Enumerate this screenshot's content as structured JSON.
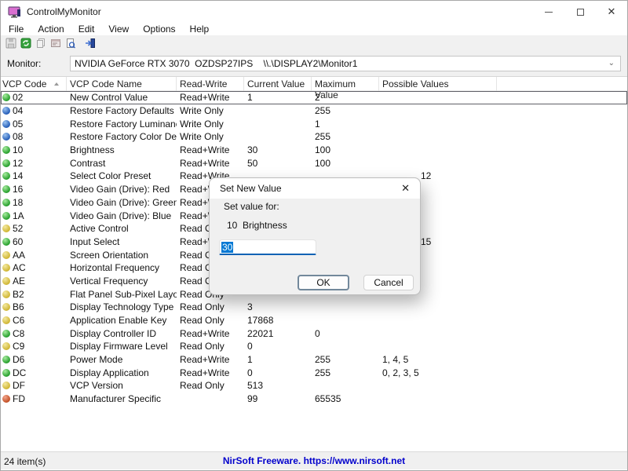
{
  "window": {
    "title": "ControlMyMonitor"
  },
  "menu": {
    "items": [
      "File",
      "Action",
      "Edit",
      "View",
      "Options",
      "Help"
    ]
  },
  "toolbar": {
    "icons": [
      "save-icon",
      "refresh-icon",
      "copy-icon",
      "properties-icon",
      "report-icon",
      "exit-icon"
    ]
  },
  "monitor_bar": {
    "label": "Monitor:",
    "value": "NVIDIA GeForce RTX 3070  OZDSP27IPS    \\\\.\\DISPLAY2\\Monitor1"
  },
  "table": {
    "columns": [
      "VCP Code",
      "VCP Code Name",
      "Read-Write",
      "Current Value",
      "Maximum Value",
      "Possible Values"
    ],
    "rows": [
      {
        "code": "02",
        "dot": "green",
        "name": "New Control Value",
        "rw": "Read+Write",
        "current": "1",
        "max": "2",
        "possible": "",
        "selected": true
      },
      {
        "code": "04",
        "dot": "blue",
        "name": "Restore Factory Defaults",
        "rw": "Write Only",
        "current": "",
        "max": "255",
        "possible": ""
      },
      {
        "code": "05",
        "dot": "blue",
        "name": "Restore Factory Luminance/ ...",
        "rw": "Write Only",
        "current": "",
        "max": "1",
        "possible": ""
      },
      {
        "code": "08",
        "dot": "blue",
        "name": "Restore Factory Color Defaul...",
        "rw": "Write Only",
        "current": "",
        "max": "255",
        "possible": ""
      },
      {
        "code": "10",
        "dot": "green",
        "name": "Brightness",
        "rw": "Read+Write",
        "current": "30",
        "max": "100",
        "possible": ""
      },
      {
        "code": "12",
        "dot": "green",
        "name": "Contrast",
        "rw": "Read+Write",
        "current": "50",
        "max": "100",
        "possible": ""
      },
      {
        "code": "14",
        "dot": "green",
        "name": "Select Color Preset",
        "rw": "Read+Write",
        "current": "",
        "max": "",
        "possible": "12",
        "possible_indent": true
      },
      {
        "code": "16",
        "dot": "green",
        "name": "Video Gain (Drive): Red",
        "rw": "Read+Write",
        "current": "",
        "max": "",
        "possible": ""
      },
      {
        "code": "18",
        "dot": "green",
        "name": "Video Gain (Drive): Green",
        "rw": "Read+Write",
        "current": "",
        "max": "",
        "possible": ""
      },
      {
        "code": "1A",
        "dot": "green",
        "name": "Video Gain (Drive): Blue",
        "rw": "Read+Write",
        "current": "",
        "max": "",
        "possible": ""
      },
      {
        "code": "52",
        "dot": "yellow",
        "name": "Active Control",
        "rw": "Read Only",
        "current": "",
        "max": "",
        "possible": ""
      },
      {
        "code": "60",
        "dot": "green",
        "name": "Input Select",
        "rw": "Read+Write",
        "current": "",
        "max": "",
        "possible": "15",
        "possible_indent": true
      },
      {
        "code": "AA",
        "dot": "yellow",
        "name": "Screen Orientation",
        "rw": "Read Only",
        "current": "",
        "max": "",
        "possible": ""
      },
      {
        "code": "AC",
        "dot": "yellow",
        "name": "Horizontal Frequency",
        "rw": "Read Only",
        "current": "",
        "max": "",
        "possible": ""
      },
      {
        "code": "AE",
        "dot": "yellow",
        "name": "Vertical Frequency",
        "rw": "Read Only",
        "current": "",
        "max": "",
        "possible": ""
      },
      {
        "code": "B2",
        "dot": "yellow",
        "name": "Flat Panel Sub-Pixel Layout",
        "rw": "Read Only",
        "current": "",
        "max": "",
        "possible": ""
      },
      {
        "code": "B6",
        "dot": "yellow",
        "name": "Display Technology Type",
        "rw": "Read Only",
        "current": "3",
        "max": "",
        "possible": ""
      },
      {
        "code": "C6",
        "dot": "yellow",
        "name": "Application Enable Key",
        "rw": "Read Only",
        "current": "17868",
        "max": "",
        "possible": ""
      },
      {
        "code": "C8",
        "dot": "green",
        "name": "Display Controller ID",
        "rw": "Read+Write",
        "current": "22021",
        "max": "0",
        "possible": ""
      },
      {
        "code": "C9",
        "dot": "yellow",
        "name": "Display Firmware Level",
        "rw": "Read Only",
        "current": "0",
        "max": "",
        "possible": ""
      },
      {
        "code": "D6",
        "dot": "green",
        "name": "Power Mode",
        "rw": "Read+Write",
        "current": "1",
        "max": "255",
        "possible": "1, 4, 5"
      },
      {
        "code": "DC",
        "dot": "green",
        "name": "Display Application",
        "rw": "Read+Write",
        "current": "0",
        "max": "255",
        "possible": "0, 2, 3, 5"
      },
      {
        "code": "DF",
        "dot": "yellow",
        "name": "VCP Version",
        "rw": "Read Only",
        "current": "513",
        "max": "",
        "possible": ""
      },
      {
        "code": "FD",
        "dot": "red",
        "name": "Manufacturer Specific",
        "rw": "",
        "current": "99",
        "max": "65535",
        "possible": ""
      }
    ]
  },
  "dialog": {
    "title": "Set New Value",
    "label": "Set value for:",
    "target": "10  Brightness",
    "input_value": "30",
    "ok_label": "OK",
    "cancel_label": "Cancel"
  },
  "statusbar": {
    "items_count": "24 item(s)",
    "link": "NirSoft Freeware. https://www.nirsoft.net"
  },
  "colors": {
    "accent_blue": "#0078d4",
    "input_underline": "#0f63b4",
    "link_blue": "#0200cc",
    "dot_green": "#1d9a24",
    "dot_blue": "#1c56b4",
    "dot_yellow": "#cdb22c",
    "dot_red": "#bf4a1e"
  }
}
